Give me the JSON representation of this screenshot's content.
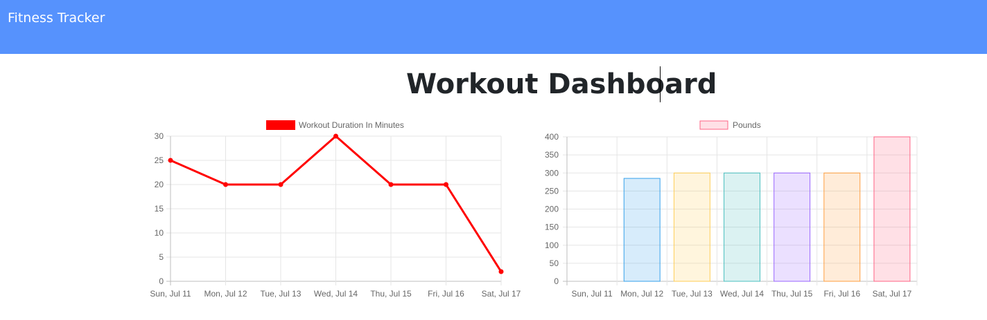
{
  "navbar": {
    "brand": "Fitness Tracker",
    "background_color": "#5692fd"
  },
  "dashboard": {
    "title": "Workout Dashboard"
  },
  "chart_data": [
    {
      "type": "line",
      "categories": [
        "Sun, Jul 11",
        "Mon, Jul 12",
        "Tue, Jul 13",
        "Wed, Jul 14",
        "Thu, Jul 15",
        "Fri, Jul 16",
        "Sat, Jul 17"
      ],
      "series": [
        {
          "name": "Workout Duration In Minutes",
          "values": [
            25,
            20,
            20,
            30,
            20,
            20,
            2
          ],
          "color": "#ff0000"
        }
      ],
      "ylim": [
        0,
        30
      ],
      "yticks": [
        0,
        5,
        10,
        15,
        20,
        25,
        30
      ],
      "grid": true,
      "legend": "top-center"
    },
    {
      "type": "bar",
      "categories": [
        "Sun, Jul 11",
        "Mon, Jul 12",
        "Tue, Jul 13",
        "Wed, Jul 14",
        "Thu, Jul 15",
        "Fri, Jul 16",
        "Sat, Jul 17"
      ],
      "series": [
        {
          "name": "Pounds",
          "values": [
            0,
            285,
            300,
            300,
            300,
            300,
            400
          ]
        }
      ],
      "bar_fill_colors": [
        "rgba(255,99,132,0.2)",
        "rgba(54,162,235,0.2)",
        "rgba(255,206,86,0.2)",
        "rgba(75,192,192,0.2)",
        "rgba(153,102,255,0.2)",
        "rgba(255,159,64,0.2)",
        "rgba(255,99,132,0.2)"
      ],
      "bar_border_colors": [
        "#ff6384",
        "#36a2eb",
        "#ffce56",
        "#4bc0c0",
        "#9966ff",
        "#ff9f40",
        "#ff6384"
      ],
      "ylim": [
        0,
        400
      ],
      "yticks": [
        0,
        50,
        100,
        150,
        200,
        250,
        300,
        350,
        400
      ],
      "grid": true,
      "legend": "top-center"
    }
  ]
}
